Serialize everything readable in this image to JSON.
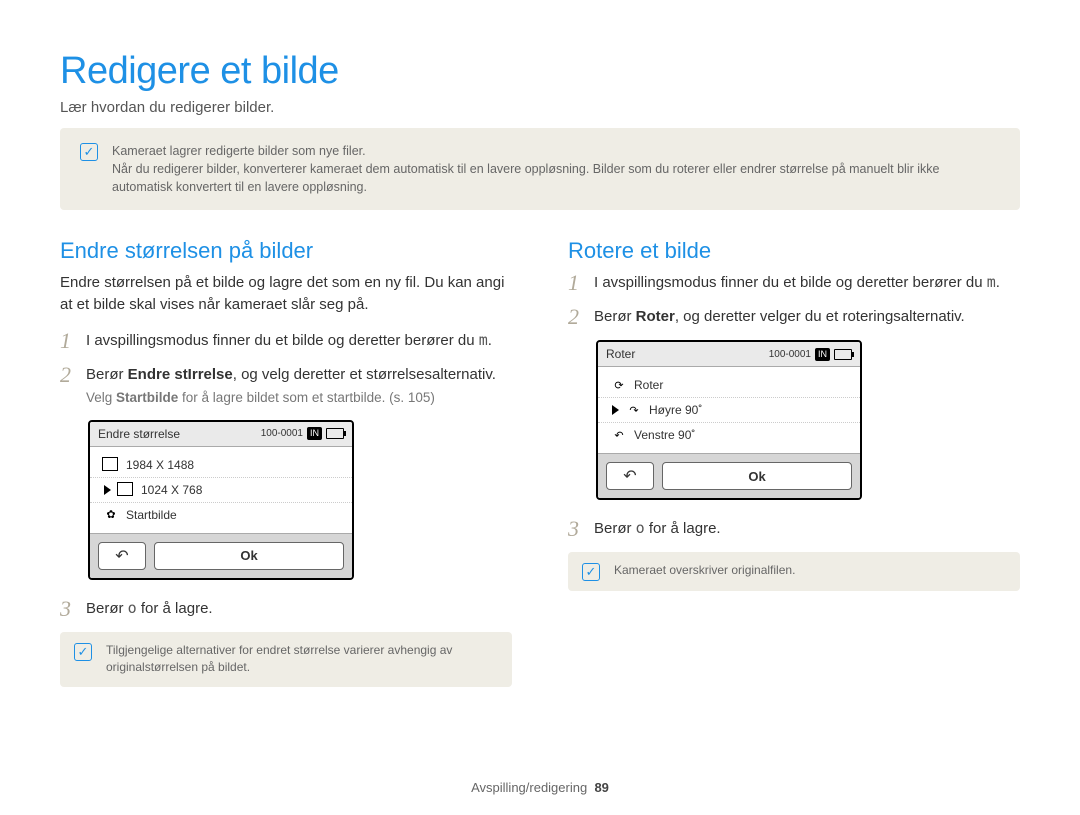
{
  "page": {
    "title": "Redigere et bilde",
    "subtitle": "Lær hvordan du redigerer bilder."
  },
  "top_note": {
    "line1": "Kameraet lagrer redigerte bilder som nye filer.",
    "line2": "Når du redigerer bilder, konverterer kameraet dem automatisk til en lavere oppløsning. Bilder som du roterer eller endrer størrelse på manuelt blir ikke automatisk konvertert til en lavere oppløsning."
  },
  "left": {
    "heading": "Endre størrelsen på bilder",
    "desc": "Endre størrelsen på et bilde og lagre det som en ny fil. Du kan angi at et bilde skal vises når kameraet slår seg på.",
    "step1_a": "I avspillingsmodus finner du et bilde og deretter berører du ",
    "step1_b": "m",
    "step1_c": ".",
    "step2_a": "Berør ",
    "step2_b": "Endre stIrrelse",
    "step2_c": ", og velg deretter et størrelsesalternativ.",
    "step2_hint_a": "Velg ",
    "step2_hint_b": "Startbilde",
    "step2_hint_c": " for å lagre bildet som et startbilde. (s. 105)",
    "step3_a": "Berør ",
    "step3_b": "o",
    "step3_c": " for å lagre.",
    "note": "Tilgjengelige alternativer for endret størrelse varierer avhengig av originalstørrelsen på bildet.",
    "device": {
      "title": "Endre størrelse",
      "counter": "100-0001",
      "chip": "IN",
      "items": [
        "1984 X 1488",
        "1024 X 768",
        "Startbilde"
      ],
      "ok": "Ok"
    }
  },
  "right": {
    "heading": "Rotere et bilde",
    "step1_a": "I avspillingsmodus finner du et bilde og deretter berører du ",
    "step1_b": "m",
    "step1_c": ".",
    "step2_a": "Berør ",
    "step2_b": "Roter",
    "step2_c": ", og deretter velger du et roteringsalternativ.",
    "step3_a": "Berør ",
    "step3_b": "o",
    "step3_c": " for å lagre.",
    "note": "Kameraet overskriver originalfilen.",
    "device": {
      "title": "Roter",
      "counter": "100-0001",
      "chip": "IN",
      "items": [
        "Roter",
        "Høyre 90˚",
        "Venstre 90˚"
      ],
      "ok": "Ok"
    }
  },
  "footer": {
    "section": "Avspilling/redigering",
    "page_num": "89"
  }
}
